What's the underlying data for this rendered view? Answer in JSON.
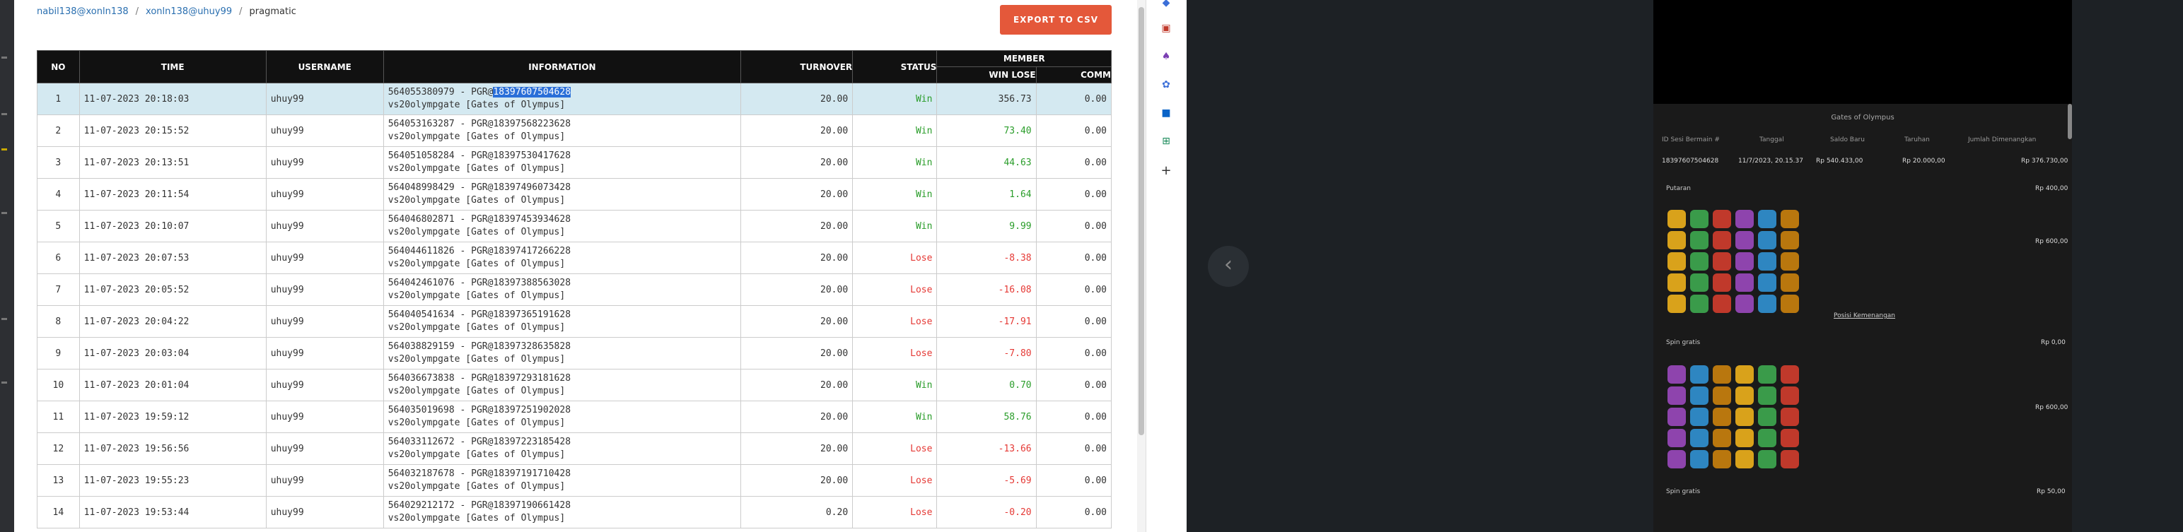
{
  "breadcrumb": {
    "item1": "nabil138@xonln138",
    "item2": "xonln138@uhuy99",
    "item3": "pragmatic",
    "sep": "/"
  },
  "export_button": "EXPORT TO CSV",
  "table": {
    "headers": {
      "no": "NO",
      "time": "TIME",
      "username": "USERNAME",
      "information": "INFORMATION",
      "turnover": "TURNOVER",
      "status": "STATUS",
      "member": "MEMBER",
      "win_lose": "WIN LOSE",
      "comm": "COMM"
    },
    "rows": [
      {
        "no": "1",
        "time": "11-07-2023 20:18:03",
        "user": "uhuy99",
        "info1a": "564055380979 - PGR@",
        "info1b": "18397607504628",
        "info2": "vs20olympgate [Gates of Olympus]",
        "turnover": "20.00",
        "status": "Win",
        "wl": "356.73",
        "comm": "0.00"
      },
      {
        "no": "2",
        "time": "11-07-2023 20:15:52",
        "user": "uhuy99",
        "info1": "564053163287 - PGR@18397568223628",
        "info2": "vs20olympgate [Gates of Olympus]",
        "turnover": "20.00",
        "status": "Win",
        "wl": "73.40",
        "comm": "0.00"
      },
      {
        "no": "3",
        "time": "11-07-2023 20:13:51",
        "user": "uhuy99",
        "info1": "564051058284 - PGR@18397530417628",
        "info2": "vs20olympgate [Gates of Olympus]",
        "turnover": "20.00",
        "status": "Win",
        "wl": "44.63",
        "comm": "0.00"
      },
      {
        "no": "4",
        "time": "11-07-2023 20:11:54",
        "user": "uhuy99",
        "info1": "564048998429 - PGR@18397496073428",
        "info2": "vs20olympgate [Gates of Olympus]",
        "turnover": "20.00",
        "status": "Win",
        "wl": "1.64",
        "comm": "0.00"
      },
      {
        "no": "5",
        "time": "11-07-2023 20:10:07",
        "user": "uhuy99",
        "info1": "564046802871 - PGR@18397453934628",
        "info2": "vs20olympgate [Gates of Olympus]",
        "turnover": "20.00",
        "status": "Win",
        "wl": "9.99",
        "comm": "0.00"
      },
      {
        "no": "6",
        "time": "11-07-2023 20:07:53",
        "user": "uhuy99",
        "info1": "564044611826 - PGR@18397417266228",
        "info2": "vs20olympgate [Gates of Olympus]",
        "turnover": "20.00",
        "status": "Lose",
        "wl": "-8.38",
        "comm": "0.00"
      },
      {
        "no": "7",
        "time": "11-07-2023 20:05:52",
        "user": "uhuy99",
        "info1": "564042461076 - PGR@18397388563028",
        "info2": "vs20olympgate [Gates of Olympus]",
        "turnover": "20.00",
        "status": "Lose",
        "wl": "-16.08",
        "comm": "0.00"
      },
      {
        "no": "8",
        "time": "11-07-2023 20:04:22",
        "user": "uhuy99",
        "info1": "564040541634 - PGR@18397365191628",
        "info2": "vs20olympgate [Gates of Olympus]",
        "turnover": "20.00",
        "status": "Lose",
        "wl": "-17.91",
        "comm": "0.00"
      },
      {
        "no": "9",
        "time": "11-07-2023 20:03:04",
        "user": "uhuy99",
        "info1": "564038829159 - PGR@18397328635828",
        "info2": "vs20olympgate [Gates of Olympus]",
        "turnover": "20.00",
        "status": "Lose",
        "wl": "-7.80",
        "comm": "0.00"
      },
      {
        "no": "10",
        "time": "11-07-2023 20:01:04",
        "user": "uhuy99",
        "info1": "564036673838 - PGR@18397293181628",
        "info2": "vs20olympgate [Gates of Olympus]",
        "turnover": "20.00",
        "status": "Win",
        "wl": "0.70",
        "comm": "0.00"
      },
      {
        "no": "11",
        "time": "11-07-2023 19:59:12",
        "user": "uhuy99",
        "info1": "564035019698 - PGR@18397251902028",
        "info2": "vs20olympgate [Gates of Olympus]",
        "turnover": "20.00",
        "status": "Win",
        "wl": "58.76",
        "comm": "0.00"
      },
      {
        "no": "12",
        "time": "11-07-2023 19:56:56",
        "user": "uhuy99",
        "info1": "564033112672 - PGR@18397223185428",
        "info2": "vs20olympgate [Gates of Olympus]",
        "turnover": "20.00",
        "status": "Lose",
        "wl": "-13.66",
        "comm": "0.00"
      },
      {
        "no": "13",
        "time": "11-07-2023 19:55:23",
        "user": "uhuy99",
        "info1": "564032187678 - PGR@18397191710428",
        "info2": "vs20olympgate [Gates of Olympus]",
        "turnover": "20.00",
        "status": "Lose",
        "wl": "-5.69",
        "comm": "0.00"
      },
      {
        "no": "14",
        "time": "11-07-2023 19:53:44",
        "user": "uhuy99",
        "info1": "564029212172 - PGR@18397190661428",
        "info2": "vs20olympgate [Gates of Olympus]",
        "turnover": "0.20",
        "status": "Lose",
        "wl": "-0.20",
        "comm": "0.00"
      }
    ]
  },
  "extensions": [
    "tag-icon",
    "toolbox-icon",
    "game-icon",
    "puzzle-icon",
    "outlook-icon",
    "cart-icon",
    "plus-icon"
  ],
  "popup": {
    "title": "Gates of Olympus",
    "headers": [
      "ID Sesi Bermain #",
      "Tanggal",
      "Saldo Baru",
      "Taruhan",
      "Jumlah Dimenangkan"
    ],
    "values": [
      "18397607504628",
      "11/7/2023, 20.15.37",
      "Rp 540.433,00",
      "Rp 20.000,00",
      "Rp 376.730,00"
    ],
    "sections": [
      {
        "label": "Putaran",
        "amount1": "Rp 400,00",
        "amount2": "Rp 600,00"
      },
      {
        "label": "Spin gratis",
        "amount1": "Rp 0,00",
        "amount2": "Rp 600,00"
      },
      {
        "label": "Spin gratis",
        "amount1": "Rp 50,00"
      }
    ],
    "win_link": "Posisi Kemenangan"
  },
  "colors": {
    "accent": "#e4583a",
    "win": "#2a9d2a",
    "lose": "#e53935",
    "link": "#2a6fb0"
  }
}
